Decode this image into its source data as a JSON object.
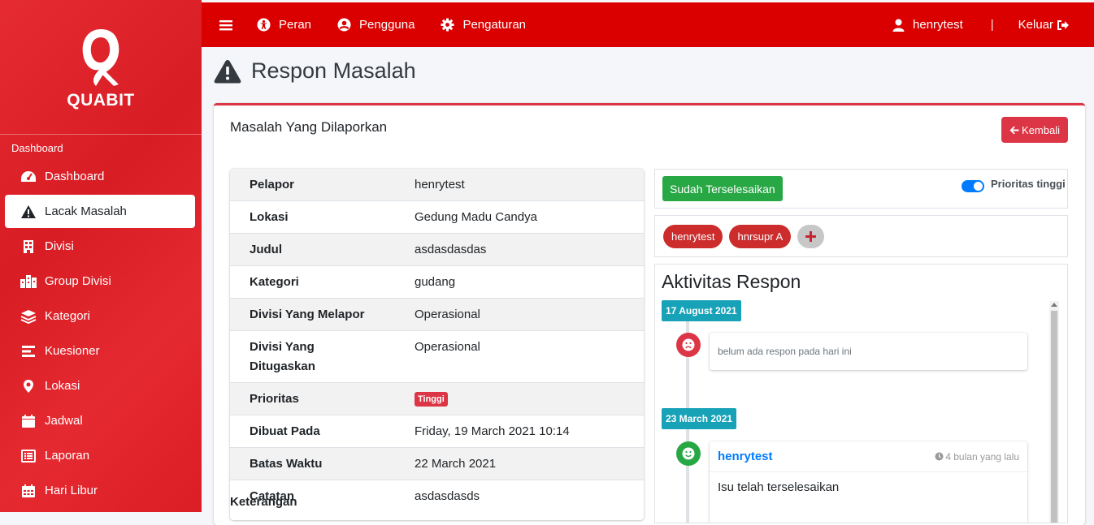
{
  "brand": {
    "name": "QUABIT"
  },
  "sidebar": {
    "header": "Dashboard",
    "items": [
      {
        "label": "Dashboard",
        "icon": "tachometer-icon"
      },
      {
        "label": "Lacak Masalah",
        "icon": "warning-icon",
        "active": true
      },
      {
        "label": "Divisi",
        "icon": "building-icon"
      },
      {
        "label": "Group Divisi",
        "icon": "city-icon"
      },
      {
        "label": "Kategori",
        "icon": "layers-icon"
      },
      {
        "label": "Kuesioner",
        "icon": "list-icon"
      },
      {
        "label": "Lokasi",
        "icon": "map-marker-icon"
      },
      {
        "label": "Jadwal",
        "icon": "calendar-icon"
      },
      {
        "label": "Laporan",
        "icon": "report-icon"
      },
      {
        "label": "Hari Libur",
        "icon": "calendar-days-icon"
      }
    ]
  },
  "topbar": {
    "links": [
      {
        "label": "Peran",
        "icon": "universal-access-icon"
      },
      {
        "label": "Pengguna",
        "icon": "user-circle-icon"
      },
      {
        "label": "Pengaturan",
        "icon": "gear-icon"
      }
    ],
    "username": "henrytest",
    "separator": "|",
    "logout": "Keluar"
  },
  "page": {
    "title": "Respon Masalah"
  },
  "card": {
    "title": "Masalah Yang Dilaporkan",
    "back_label": "Kembali",
    "details": [
      {
        "key": "Pelapor",
        "value": "henrytest"
      },
      {
        "key": "Lokasi",
        "value": "Gedung Madu Candya"
      },
      {
        "key": "Judul",
        "value": "asdasdasdas"
      },
      {
        "key": "Kategori",
        "value": "gudang"
      },
      {
        "key": "Divisi Yang Melapor",
        "value": "Operasional"
      },
      {
        "key": "Divisi Yang Ditugaskan",
        "value": "Operasional"
      },
      {
        "key": "Prioritas",
        "value": "Tinggi"
      },
      {
        "key": "Dibuat Pada",
        "value": "Friday, 19 March 2021 10:14"
      },
      {
        "key": "Batas Waktu",
        "value": "22 March 2021"
      },
      {
        "key": "Catatan",
        "value": "asdasdasds"
      }
    ],
    "keterangan_label": "Keterangan"
  },
  "status": {
    "done_label": "Sudah Terselesaikan",
    "priority_toggle_label": "Prioritas tinggi",
    "priority_toggle_on": true
  },
  "assignees": [
    "henrytest",
    "hnrsupr A"
  ],
  "activity": {
    "title": "Aktivitas Respon",
    "entries": [
      {
        "date": "17 August 2021",
        "text": "belum ada respon pada hari ini",
        "mood": "sad"
      },
      {
        "date": "23 March 2021",
        "user": "henrytest",
        "time": "4 bulan yang lalu",
        "text": "Isu telah terselesaikan",
        "mood": "happy"
      }
    ]
  },
  "colors": {
    "primary_red": "#da0000",
    "danger": "#dc3545",
    "success": "#28a745",
    "info": "#17a2b8",
    "link": "#007bff"
  }
}
